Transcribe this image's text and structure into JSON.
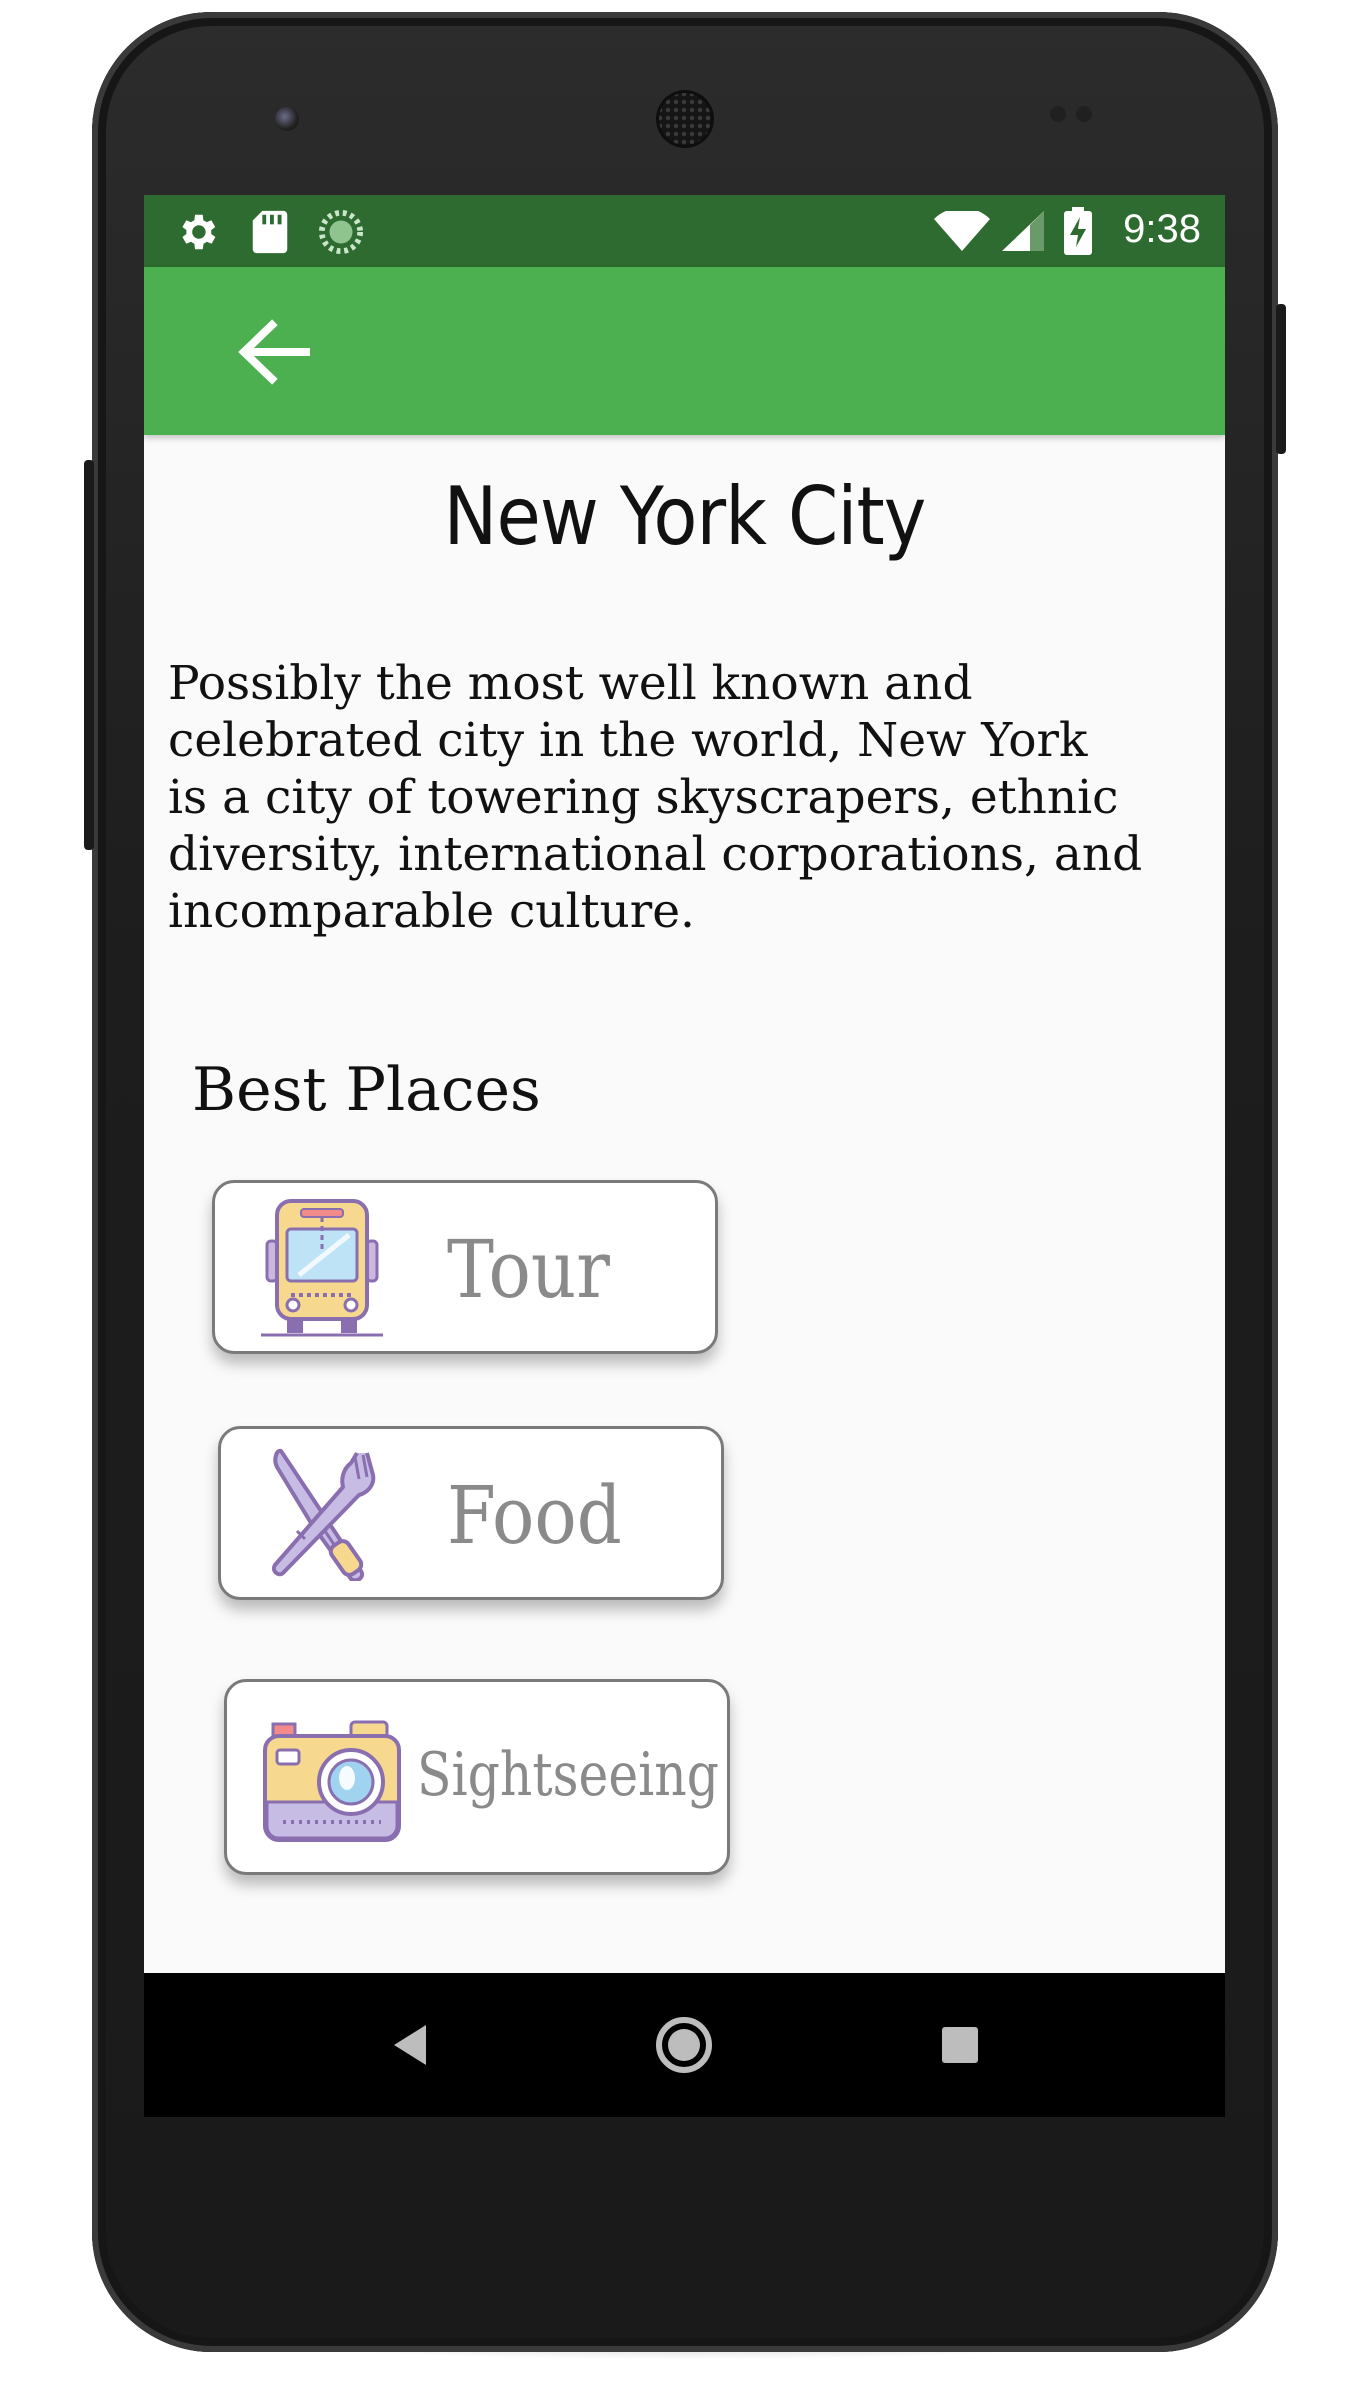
{
  "status_bar": {
    "time": "9:38",
    "left_icons": [
      "settings-icon",
      "sd-card-icon",
      "sync-icon"
    ],
    "right_icons": [
      "wifi-icon",
      "signal-icon",
      "battery-charging-icon"
    ],
    "background": "#2e6b30"
  },
  "app_bar": {
    "back_icon": "arrow-left-icon",
    "background": "#4caf50"
  },
  "city": {
    "title": "New York City",
    "description_lines": [
      "Possibly the most well known and",
      "celebrated city in the world, New York",
      "is a city of towering skyscrapers, ethnic",
      "diversity, international corporations, and",
      "incomparable culture."
    ]
  },
  "best_places": {
    "heading": "Best Places",
    "items": [
      {
        "label": "Tour",
        "icon": "bus-icon"
      },
      {
        "label": "Food",
        "icon": "knife-fork-icon"
      },
      {
        "label": "Sightseeing",
        "icon": "camera-icon"
      }
    ]
  },
  "nav_bar": {
    "buttons": [
      "back-triangle-icon",
      "home-circle-icon",
      "recents-square-icon"
    ]
  }
}
